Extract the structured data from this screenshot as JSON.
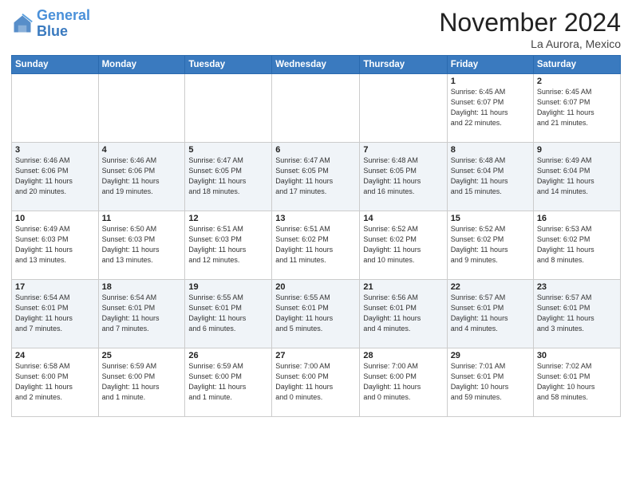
{
  "header": {
    "logo_general": "General",
    "logo_blue": "Blue",
    "month_title": "November 2024",
    "location": "La Aurora, Mexico"
  },
  "weekdays": [
    "Sunday",
    "Monday",
    "Tuesday",
    "Wednesday",
    "Thursday",
    "Friday",
    "Saturday"
  ],
  "weeks": [
    [
      {
        "day": "",
        "info": ""
      },
      {
        "day": "",
        "info": ""
      },
      {
        "day": "",
        "info": ""
      },
      {
        "day": "",
        "info": ""
      },
      {
        "day": "",
        "info": ""
      },
      {
        "day": "1",
        "info": "Sunrise: 6:45 AM\nSunset: 6:07 PM\nDaylight: 11 hours\nand 22 minutes."
      },
      {
        "day": "2",
        "info": "Sunrise: 6:45 AM\nSunset: 6:07 PM\nDaylight: 11 hours\nand 21 minutes."
      }
    ],
    [
      {
        "day": "3",
        "info": "Sunrise: 6:46 AM\nSunset: 6:06 PM\nDaylight: 11 hours\nand 20 minutes."
      },
      {
        "day": "4",
        "info": "Sunrise: 6:46 AM\nSunset: 6:06 PM\nDaylight: 11 hours\nand 19 minutes."
      },
      {
        "day": "5",
        "info": "Sunrise: 6:47 AM\nSunset: 6:05 PM\nDaylight: 11 hours\nand 18 minutes."
      },
      {
        "day": "6",
        "info": "Sunrise: 6:47 AM\nSunset: 6:05 PM\nDaylight: 11 hours\nand 17 minutes."
      },
      {
        "day": "7",
        "info": "Sunrise: 6:48 AM\nSunset: 6:05 PM\nDaylight: 11 hours\nand 16 minutes."
      },
      {
        "day": "8",
        "info": "Sunrise: 6:48 AM\nSunset: 6:04 PM\nDaylight: 11 hours\nand 15 minutes."
      },
      {
        "day": "9",
        "info": "Sunrise: 6:49 AM\nSunset: 6:04 PM\nDaylight: 11 hours\nand 14 minutes."
      }
    ],
    [
      {
        "day": "10",
        "info": "Sunrise: 6:49 AM\nSunset: 6:03 PM\nDaylight: 11 hours\nand 13 minutes."
      },
      {
        "day": "11",
        "info": "Sunrise: 6:50 AM\nSunset: 6:03 PM\nDaylight: 11 hours\nand 13 minutes."
      },
      {
        "day": "12",
        "info": "Sunrise: 6:51 AM\nSunset: 6:03 PM\nDaylight: 11 hours\nand 12 minutes."
      },
      {
        "day": "13",
        "info": "Sunrise: 6:51 AM\nSunset: 6:02 PM\nDaylight: 11 hours\nand 11 minutes."
      },
      {
        "day": "14",
        "info": "Sunrise: 6:52 AM\nSunset: 6:02 PM\nDaylight: 11 hours\nand 10 minutes."
      },
      {
        "day": "15",
        "info": "Sunrise: 6:52 AM\nSunset: 6:02 PM\nDaylight: 11 hours\nand 9 minutes."
      },
      {
        "day": "16",
        "info": "Sunrise: 6:53 AM\nSunset: 6:02 PM\nDaylight: 11 hours\nand 8 minutes."
      }
    ],
    [
      {
        "day": "17",
        "info": "Sunrise: 6:54 AM\nSunset: 6:01 PM\nDaylight: 11 hours\nand 7 minutes."
      },
      {
        "day": "18",
        "info": "Sunrise: 6:54 AM\nSunset: 6:01 PM\nDaylight: 11 hours\nand 7 minutes."
      },
      {
        "day": "19",
        "info": "Sunrise: 6:55 AM\nSunset: 6:01 PM\nDaylight: 11 hours\nand 6 minutes."
      },
      {
        "day": "20",
        "info": "Sunrise: 6:55 AM\nSunset: 6:01 PM\nDaylight: 11 hours\nand 5 minutes."
      },
      {
        "day": "21",
        "info": "Sunrise: 6:56 AM\nSunset: 6:01 PM\nDaylight: 11 hours\nand 4 minutes."
      },
      {
        "day": "22",
        "info": "Sunrise: 6:57 AM\nSunset: 6:01 PM\nDaylight: 11 hours\nand 4 minutes."
      },
      {
        "day": "23",
        "info": "Sunrise: 6:57 AM\nSunset: 6:01 PM\nDaylight: 11 hours\nand 3 minutes."
      }
    ],
    [
      {
        "day": "24",
        "info": "Sunrise: 6:58 AM\nSunset: 6:00 PM\nDaylight: 11 hours\nand 2 minutes."
      },
      {
        "day": "25",
        "info": "Sunrise: 6:59 AM\nSunset: 6:00 PM\nDaylight: 11 hours\nand 1 minute."
      },
      {
        "day": "26",
        "info": "Sunrise: 6:59 AM\nSunset: 6:00 PM\nDaylight: 11 hours\nand 1 minute."
      },
      {
        "day": "27",
        "info": "Sunrise: 7:00 AM\nSunset: 6:00 PM\nDaylight: 11 hours\nand 0 minutes."
      },
      {
        "day": "28",
        "info": "Sunrise: 7:00 AM\nSunset: 6:00 PM\nDaylight: 11 hours\nand 0 minutes."
      },
      {
        "day": "29",
        "info": "Sunrise: 7:01 AM\nSunset: 6:01 PM\nDaylight: 10 hours\nand 59 minutes."
      },
      {
        "day": "30",
        "info": "Sunrise: 7:02 AM\nSunset: 6:01 PM\nDaylight: 10 hours\nand 58 minutes."
      }
    ]
  ]
}
